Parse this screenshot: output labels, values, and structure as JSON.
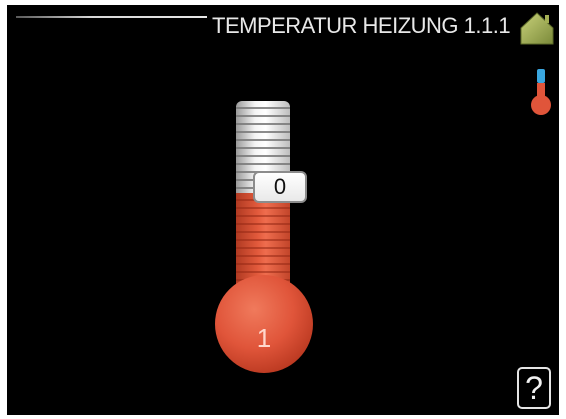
{
  "header": {
    "title": "TEMPERATUR HEIZUNG 1.1.1",
    "home_icon": "house-icon",
    "mode_icon": "thermometer-icon"
  },
  "thermometer": {
    "setpoint_value": "0",
    "bulb_value": "1",
    "colors": {
      "warm": "#e0553a",
      "cold": "#d8d8d8",
      "cold_accent": "#3aa7e0"
    }
  },
  "help": {
    "label": "?"
  }
}
